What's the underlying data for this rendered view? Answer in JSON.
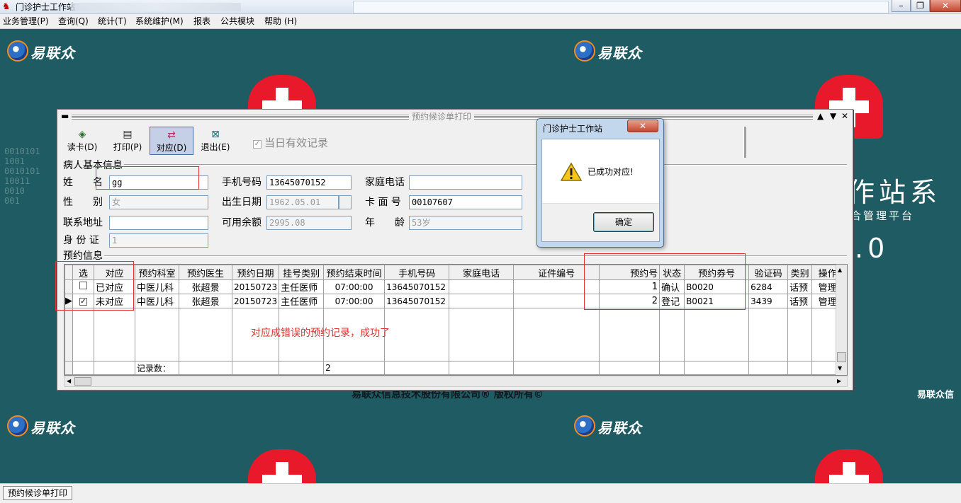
{
  "app": {
    "title": "门诊护士工作站"
  },
  "menu": [
    "业务管理(P)",
    "查询(Q)",
    "统计(T)",
    "系统维护(M)",
    "报表",
    "公共模块",
    "帮助 (H)"
  ],
  "background": {
    "logo_text": "易联众",
    "big_text": "作站系",
    "big_digit": ".0",
    "sub_text": "合管理平台",
    "footer": "易联众信息技术股份有限公司® 版权所有©",
    "footer_right": "易联众信"
  },
  "child": {
    "title": "预约候诊单打印",
    "toolbar": {
      "read_card": "读卡(D)",
      "print": "打印(P)",
      "match": "对应(D)",
      "exit": "退出(E)"
    },
    "today_only": "当日有效记录",
    "patient": {
      "group": "病人基本信息",
      "labels": {
        "name": "姓　　名",
        "gender": "性　　别",
        "address": "联系地址",
        "id": "身 份 证",
        "mobile": "手机号码",
        "birth": "出生日期",
        "balance": "可用余额",
        "home_phone": "家庭电话",
        "card_no": "卡 面 号",
        "age": "年　　龄"
      },
      "values": {
        "name": "gg",
        "gender": "女",
        "address": "",
        "id": "1",
        "mobile": "13645070152",
        "birth": "1962.05.01",
        "balance": "2995.08",
        "home_phone": "",
        "card_no": "00107607",
        "age": "53岁"
      }
    },
    "appointment": {
      "group": "预约信息",
      "columns": [
        "选",
        "对应",
        "预约科室",
        "预约医生",
        "预约日期",
        "挂号类别",
        "预约结束时间",
        "手机号码",
        "家庭电话",
        "证件编号",
        "预约号",
        "状态",
        "预约券号",
        "验证码",
        "类别",
        "操作"
      ],
      "rows": [
        {
          "checked": false,
          "match": "已对应",
          "dept": "中医儿科",
          "doctor": "张超景",
          "date": "20150723",
          "reg_type": "主任医师",
          "end_time": "07:00:00",
          "mobile": "13645070152",
          "home": "",
          "cert": "",
          "no": "1",
          "status": "确认",
          "ticket": "B0020",
          "verify": "6284",
          "kind": "话预",
          "op": "管理"
        },
        {
          "checked": true,
          "match": "未对应",
          "dept": "中医儿科",
          "doctor": "张超景",
          "date": "20150723",
          "reg_type": "主任医师",
          "end_time": "07:00:00",
          "mobile": "13645070152",
          "home": "",
          "cert": "",
          "no": "2",
          "status": "登记",
          "ticket": "B0021",
          "verify": "3439",
          "kind": "话预",
          "op": "管理"
        }
      ],
      "summary_label": "记录数：",
      "summary_count": "2"
    },
    "annotation": "对应成错误的预约记录，成功了"
  },
  "dialog": {
    "title": "门诊护士工作站",
    "message": "已成功对应!",
    "ok": "确定"
  },
  "statusbar": {
    "tab": "预约候诊单打印"
  },
  "colors": {
    "desktop": "#1f5b62",
    "annotation": "#e03030",
    "cross": "#e7192a"
  }
}
